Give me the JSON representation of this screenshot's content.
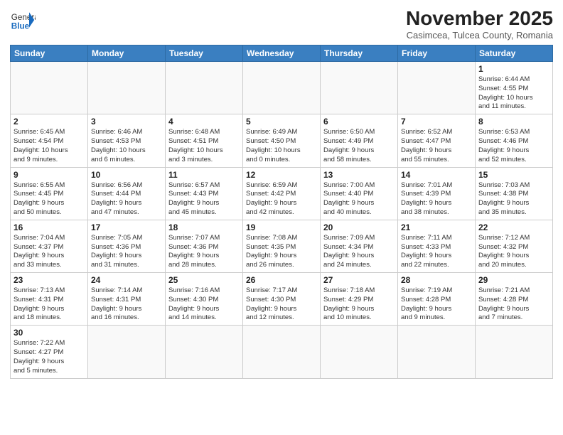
{
  "header": {
    "logo_line1": "General",
    "logo_line2": "Blue",
    "title": "November 2025",
    "subtitle": "Casimcea, Tulcea County, Romania"
  },
  "weekdays": [
    "Sunday",
    "Monday",
    "Tuesday",
    "Wednesday",
    "Thursday",
    "Friday",
    "Saturday"
  ],
  "weeks": [
    [
      {
        "num": "",
        "info": ""
      },
      {
        "num": "",
        "info": ""
      },
      {
        "num": "",
        "info": ""
      },
      {
        "num": "",
        "info": ""
      },
      {
        "num": "",
        "info": ""
      },
      {
        "num": "",
        "info": ""
      },
      {
        "num": "1",
        "info": "Sunrise: 6:44 AM\nSunset: 4:55 PM\nDaylight: 10 hours\nand 11 minutes."
      }
    ],
    [
      {
        "num": "2",
        "info": "Sunrise: 6:45 AM\nSunset: 4:54 PM\nDaylight: 10 hours\nand 9 minutes."
      },
      {
        "num": "3",
        "info": "Sunrise: 6:46 AM\nSunset: 4:53 PM\nDaylight: 10 hours\nand 6 minutes."
      },
      {
        "num": "4",
        "info": "Sunrise: 6:48 AM\nSunset: 4:51 PM\nDaylight: 10 hours\nand 3 minutes."
      },
      {
        "num": "5",
        "info": "Sunrise: 6:49 AM\nSunset: 4:50 PM\nDaylight: 10 hours\nand 0 minutes."
      },
      {
        "num": "6",
        "info": "Sunrise: 6:50 AM\nSunset: 4:49 PM\nDaylight: 9 hours\nand 58 minutes."
      },
      {
        "num": "7",
        "info": "Sunrise: 6:52 AM\nSunset: 4:47 PM\nDaylight: 9 hours\nand 55 minutes."
      },
      {
        "num": "8",
        "info": "Sunrise: 6:53 AM\nSunset: 4:46 PM\nDaylight: 9 hours\nand 52 minutes."
      }
    ],
    [
      {
        "num": "9",
        "info": "Sunrise: 6:55 AM\nSunset: 4:45 PM\nDaylight: 9 hours\nand 50 minutes."
      },
      {
        "num": "10",
        "info": "Sunrise: 6:56 AM\nSunset: 4:44 PM\nDaylight: 9 hours\nand 47 minutes."
      },
      {
        "num": "11",
        "info": "Sunrise: 6:57 AM\nSunset: 4:43 PM\nDaylight: 9 hours\nand 45 minutes."
      },
      {
        "num": "12",
        "info": "Sunrise: 6:59 AM\nSunset: 4:42 PM\nDaylight: 9 hours\nand 42 minutes."
      },
      {
        "num": "13",
        "info": "Sunrise: 7:00 AM\nSunset: 4:40 PM\nDaylight: 9 hours\nand 40 minutes."
      },
      {
        "num": "14",
        "info": "Sunrise: 7:01 AM\nSunset: 4:39 PM\nDaylight: 9 hours\nand 38 minutes."
      },
      {
        "num": "15",
        "info": "Sunrise: 7:03 AM\nSunset: 4:38 PM\nDaylight: 9 hours\nand 35 minutes."
      }
    ],
    [
      {
        "num": "16",
        "info": "Sunrise: 7:04 AM\nSunset: 4:37 PM\nDaylight: 9 hours\nand 33 minutes."
      },
      {
        "num": "17",
        "info": "Sunrise: 7:05 AM\nSunset: 4:36 PM\nDaylight: 9 hours\nand 31 minutes."
      },
      {
        "num": "18",
        "info": "Sunrise: 7:07 AM\nSunset: 4:36 PM\nDaylight: 9 hours\nand 28 minutes."
      },
      {
        "num": "19",
        "info": "Sunrise: 7:08 AM\nSunset: 4:35 PM\nDaylight: 9 hours\nand 26 minutes."
      },
      {
        "num": "20",
        "info": "Sunrise: 7:09 AM\nSunset: 4:34 PM\nDaylight: 9 hours\nand 24 minutes."
      },
      {
        "num": "21",
        "info": "Sunrise: 7:11 AM\nSunset: 4:33 PM\nDaylight: 9 hours\nand 22 minutes."
      },
      {
        "num": "22",
        "info": "Sunrise: 7:12 AM\nSunset: 4:32 PM\nDaylight: 9 hours\nand 20 minutes."
      }
    ],
    [
      {
        "num": "23",
        "info": "Sunrise: 7:13 AM\nSunset: 4:31 PM\nDaylight: 9 hours\nand 18 minutes."
      },
      {
        "num": "24",
        "info": "Sunrise: 7:14 AM\nSunset: 4:31 PM\nDaylight: 9 hours\nand 16 minutes."
      },
      {
        "num": "25",
        "info": "Sunrise: 7:16 AM\nSunset: 4:30 PM\nDaylight: 9 hours\nand 14 minutes."
      },
      {
        "num": "26",
        "info": "Sunrise: 7:17 AM\nSunset: 4:30 PM\nDaylight: 9 hours\nand 12 minutes."
      },
      {
        "num": "27",
        "info": "Sunrise: 7:18 AM\nSunset: 4:29 PM\nDaylight: 9 hours\nand 10 minutes."
      },
      {
        "num": "28",
        "info": "Sunrise: 7:19 AM\nSunset: 4:28 PM\nDaylight: 9 hours\nand 9 minutes."
      },
      {
        "num": "29",
        "info": "Sunrise: 7:21 AM\nSunset: 4:28 PM\nDaylight: 9 hours\nand 7 minutes."
      }
    ],
    [
      {
        "num": "30",
        "info": "Sunrise: 7:22 AM\nSunset: 4:27 PM\nDaylight: 9 hours\nand 5 minutes."
      },
      {
        "num": "",
        "info": ""
      },
      {
        "num": "",
        "info": ""
      },
      {
        "num": "",
        "info": ""
      },
      {
        "num": "",
        "info": ""
      },
      {
        "num": "",
        "info": ""
      },
      {
        "num": "",
        "info": ""
      }
    ]
  ]
}
